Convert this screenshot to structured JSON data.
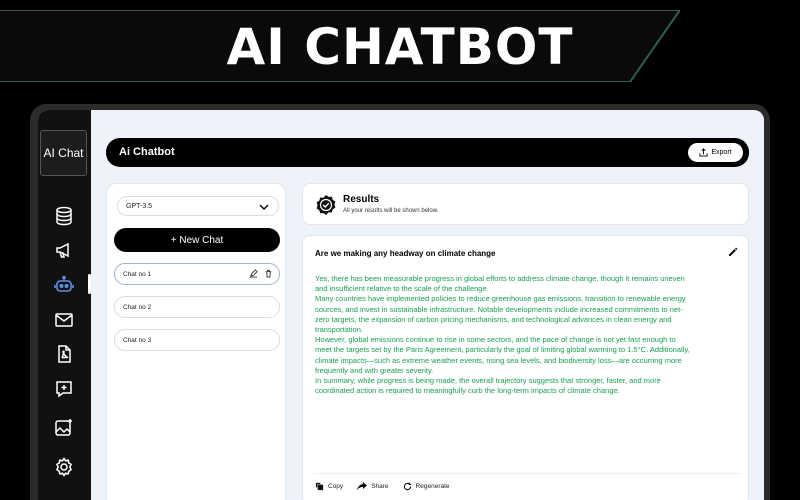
{
  "banner": {
    "title": "AI CHATBOT"
  },
  "sidebar": {
    "logo": "AI Chat",
    "icons": [
      "database-icon",
      "megaphone-icon",
      "robot-icon",
      "mail-icon",
      "pdf-icon",
      "chat-plus-icon",
      "image-plus-icon",
      "settings-icon"
    ]
  },
  "topbar": {
    "title": "Ai Chatbot",
    "export_label": "Export"
  },
  "left_panel": {
    "model": "GPT-3.5",
    "new_chat_label": "+ New Chat",
    "chats": [
      {
        "label": "Chat no 1",
        "active": true
      },
      {
        "label": "Chat no 2",
        "active": false
      },
      {
        "label": "Chat no 3",
        "active": false
      }
    ]
  },
  "results": {
    "title": "Results",
    "subtitle": "All your results will be shown below."
  },
  "answer": {
    "question": "Are we making any headway on climate change",
    "paragraphs": [
      "Yes, there has been measurable progress in global efforts to address climate change, though it remains uneven and insufficient relative to the scale of the challenge.",
      "Many countries have implemented policies to reduce greenhouse gas emissions, transition to renewable energy sources, and invest in sustainable infrastructure. Notable developments include increased commitments to net-zero targets, the expansion of carbon pricing mechanisms, and technological advances in clean energy and transportation.",
      "However, global emissions continue to rise in some sectors, and the pace of change is not yet fast enough to meet the targets set by the Paris Agreement, particularly the goal of limiting global warming to 1.5°C. Additionally, climate impacts—such as extreme weather events, rising sea levels, and biodiversity loss—are occurring more frequently and with greater severity.",
      "In summary, while progress is being made, the overall trajectory suggests that stronger, faster, and more coordinated action is required to meaningfully curb the long-term impacts of climate change."
    ],
    "copy_label": "Copy",
    "share_label": "Share",
    "regenerate_label": "Regenerate"
  },
  "colors": {
    "accent": "#1aa053",
    "banner_border": "#2f5f4a"
  }
}
